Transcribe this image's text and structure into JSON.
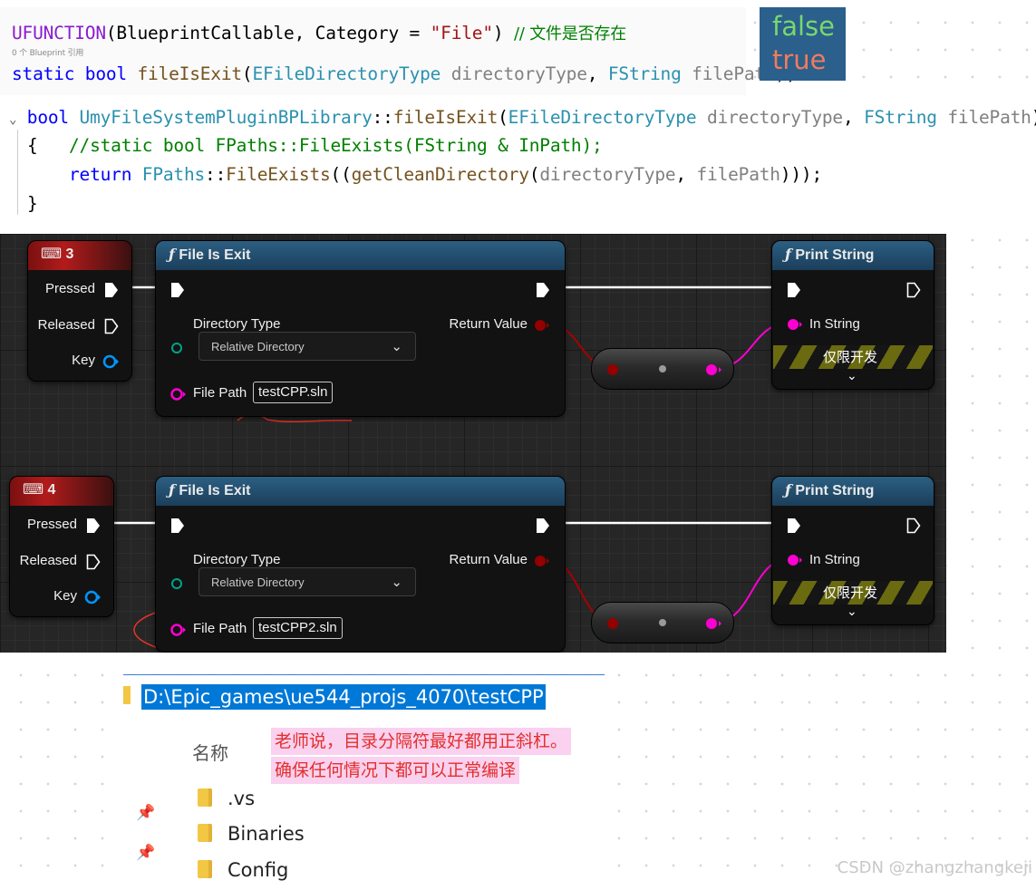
{
  "code_top": {
    "macro": "UFUNCTION",
    "macro_args_open": "(BlueprintCallable, Category = ",
    "macro_string": "\"File\"",
    "macro_close": ") ",
    "comment": "// 文件是否存在",
    "hint": "0 个 Blueprint 引用",
    "kw_static": "static",
    "kw_bool": "bool",
    "func": "fileIsExit",
    "open": "(",
    "type1": "EFileDirectoryType",
    "param1": " directoryType",
    "sep": ", ",
    "type2": "FString",
    "param2": " filePath",
    "close": ");"
  },
  "badge": {
    "false_text": "false",
    "true_text": "true"
  },
  "code_bottom": {
    "fold": "⌄",
    "kw_bool": "bool",
    "class": "UmyFileSystemPluginBPLibrary",
    "scope": "::",
    "func": "fileIsExit",
    "open": "(",
    "type1": "EFileDirectoryType",
    "param1": " directoryType",
    "sep": ", ",
    "type2": "FString",
    "param2": " filePath",
    "close": ")",
    "brace_open": "{",
    "comment_line": "//static bool FPaths::FileExists(FString & InPath);",
    "kw_return": "return",
    "fpaths": "FPaths",
    "scope2": "::",
    "fileexists": "FileExists",
    "call_open": "((",
    "getclean": "getCleanDirectory",
    "call_args_open": "(",
    "arg1": "directoryType",
    "arg_sep": ", ",
    "arg2": "filePath",
    "call_close": ")));",
    "brace_close": "}"
  },
  "blueprint": {
    "rows": [
      {
        "key_label": "3",
        "pressed": "Pressed",
        "released": "Released",
        "key": "Key",
        "func_title": "File Is Exit",
        "dir_type": "Directory Type",
        "dir_value": "Relative Directory",
        "return_value": "Return Value",
        "file_path": "File Path",
        "file_value": "testCPP.sln",
        "print_title": "Print String",
        "in_string": "In String",
        "dev_only": "仅限开发"
      },
      {
        "key_label": "4",
        "pressed": "Pressed",
        "released": "Released",
        "key": "Key",
        "func_title": "File Is Exit",
        "dir_type": "Directory Type",
        "dir_value": "Relative Directory",
        "return_value": "Return Value",
        "file_path": "File Path",
        "file_value": "testCPP2.sln",
        "print_title": "Print String",
        "in_string": "In String",
        "dev_only": "仅限开发"
      }
    ],
    "colors": {
      "exec": "#ffffff",
      "bool_pin": "#940000",
      "string_pin": "#fb00d1",
      "struct_pin": "#0095ff",
      "annotation": "#e8332a"
    }
  },
  "explorer": {
    "address": "D:\\Epic_games\\ue544_projs_4070\\testCPP",
    "column_name": "名称",
    "note_line1": "老师说，目录分隔符最好都用正斜杠。",
    "note_line2": "确保任何情况下都可以正常编译",
    "folders": [
      ".vs",
      "Binaries",
      "Config"
    ]
  },
  "watermark": "CSDN @zhangzhangkeji"
}
